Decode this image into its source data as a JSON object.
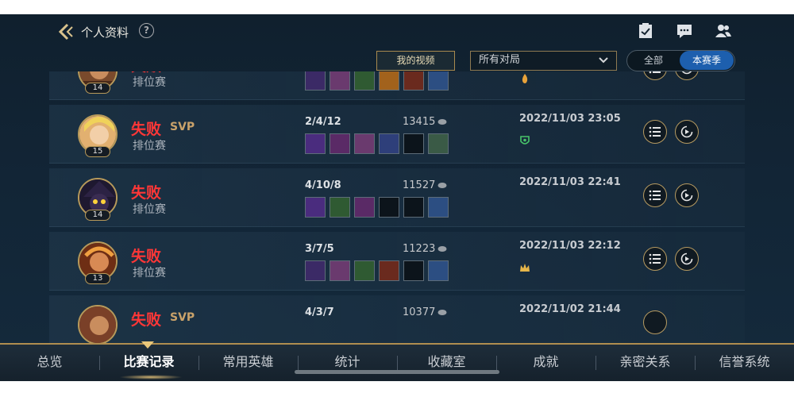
{
  "header": {
    "title": "个人资料",
    "help": "?"
  },
  "filters": {
    "video_button": "我的视频",
    "mode_select": "所有对局",
    "season_toggle": {
      "all": "全部",
      "current": "本赛季",
      "selected": "current"
    }
  },
  "matches": [
    {
      "result": "失败",
      "svp": "",
      "queue": "排位赛",
      "level": "14",
      "kda": "",
      "gold": "",
      "datetime": "",
      "items": [
        "item-1",
        "item-2",
        "item-3",
        "item-4",
        "item-5",
        "item-6"
      ],
      "badge": "flame-badge-icon"
    },
    {
      "result": "失败",
      "svp": "SVP",
      "queue": "排位赛",
      "level": "15",
      "kda": "2/4/12",
      "gold": "13415",
      "datetime": "2022/11/03 23:05",
      "items": [
        "item-1",
        "item-2",
        "item-3",
        "item-4",
        "empty",
        "item-6"
      ],
      "badge": "shield-badge-icon"
    },
    {
      "result": "失败",
      "svp": "",
      "queue": "排位赛",
      "level": "14",
      "kda": "4/10/8",
      "gold": "11527",
      "datetime": "2022/11/03 22:41",
      "items": [
        "item-1",
        "item-2",
        "item-3",
        "empty",
        "empty",
        "item-6"
      ],
      "badge": ""
    },
    {
      "result": "失败",
      "svp": "",
      "queue": "排位赛",
      "level": "13",
      "kda": "3/7/5",
      "gold": "11223",
      "datetime": "2022/11/03 22:12",
      "items": [
        "item-1",
        "item-2",
        "item-3",
        "item-4",
        "empty",
        "item-6"
      ],
      "badge": "crown-badge-icon"
    },
    {
      "result": "失败",
      "svp": "SVP",
      "queue": "",
      "level": "",
      "kda": "4/3/7",
      "gold": "10377",
      "datetime": "2022/11/02 21:44",
      "items": [],
      "badge": ""
    }
  ],
  "bottom_nav": [
    "总览",
    "比赛记录",
    "常用英雄",
    "统计",
    "收藏室",
    "成就",
    "亲密关系",
    "信誉系统"
  ],
  "active_nav_index": 1,
  "colors": {
    "loss": "#ff3737",
    "gold_accent": "#b89a5a",
    "toggle_active": "#1d5fae"
  }
}
